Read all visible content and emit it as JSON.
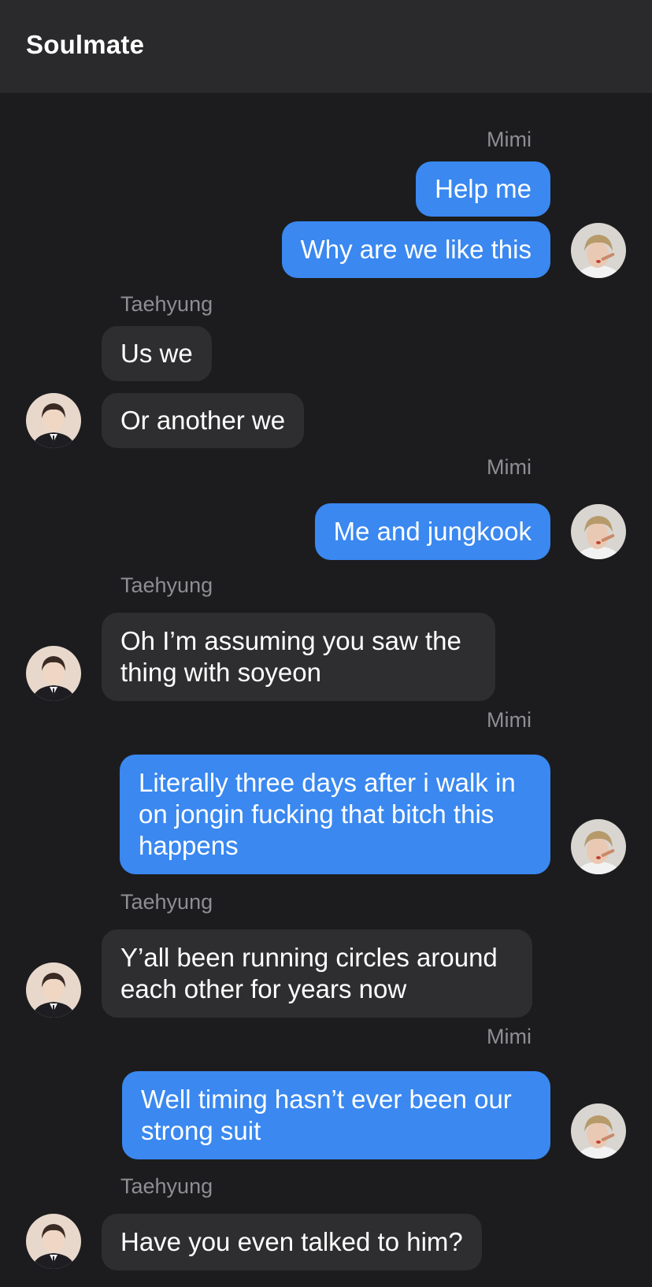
{
  "header": {
    "title": "Soulmate"
  },
  "messages": [
    {
      "sender": "Mimi",
      "side": "right",
      "lines": [
        "Help me"
      ]
    },
    {
      "sender": "Mimi",
      "side": "right",
      "lines": [
        "Why are we like this"
      ]
    },
    {
      "sender": "Taehyung",
      "side": "left",
      "lines": [
        "Us we"
      ]
    },
    {
      "sender": "Taehyung",
      "side": "left",
      "lines": [
        "Or another we"
      ]
    },
    {
      "sender": "Mimi",
      "side": "right",
      "lines": [
        "Me and jungkook"
      ]
    },
    {
      "sender": "Taehyung",
      "side": "left",
      "lines": [
        "Oh I’m assuming you saw the",
        "thing with soyeon"
      ]
    },
    {
      "sender": "Mimi",
      "side": "right",
      "lines": [
        "Literally three days after i walk in",
        "on jongin fucking that bitch this",
        "happens"
      ]
    },
    {
      "sender": "Taehyung",
      "side": "left",
      "lines": [
        "Y’all been running circles around",
        "each other for years now"
      ]
    },
    {
      "sender": "Mimi",
      "side": "right",
      "lines": [
        "Well timing hasn’t ever been our",
        "strong suit"
      ]
    },
    {
      "sender": "Taehyung",
      "side": "left",
      "lines": [
        "Have you even talked to him?"
      ]
    }
  ],
  "names": {
    "me": "Mimi",
    "them": "Taehyung"
  },
  "colors": {
    "background": "#1c1c1e",
    "header_bg": "#2a2a2c",
    "my_bubble": "#3a88f0",
    "their_bubble": "#2e2e30",
    "sender_name": "#8e8e93"
  },
  "icons": {
    "me_avatar": "mimi-avatar-photo",
    "them_avatar": "taehyung-avatar-photo"
  }
}
